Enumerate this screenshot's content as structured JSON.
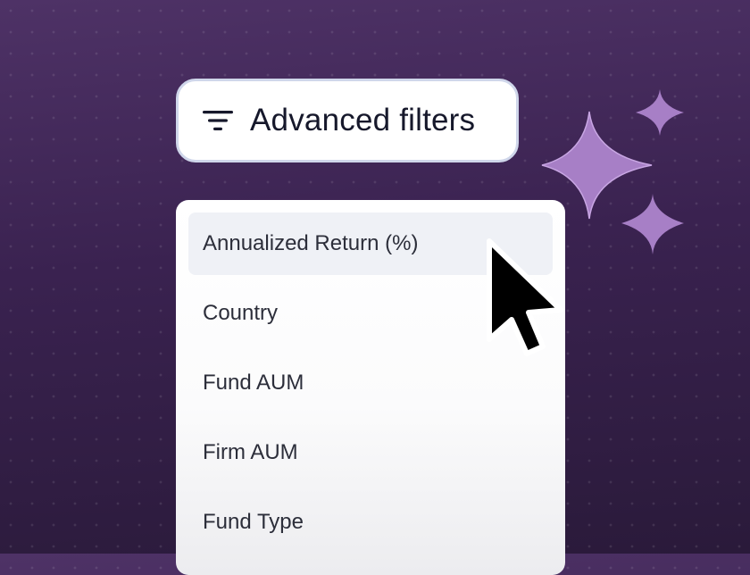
{
  "filters_button": {
    "label": "Advanced filters",
    "icon": "filter-lines-icon"
  },
  "dropdown": {
    "options": [
      {
        "label": "Annualized Return (%)",
        "highlighted": true
      },
      {
        "label": "Country",
        "highlighted": false
      },
      {
        "label": "Fund AUM",
        "highlighted": false
      },
      {
        "label": "Firm AUM",
        "highlighted": false
      },
      {
        "label": "Fund Type",
        "highlighted": false
      }
    ]
  },
  "decorations": {
    "sparkle_color": "#a77fc6",
    "cursor_icon": "pointer-arrow-icon"
  },
  "colors": {
    "background_top": "#4e3266",
    "background_bottom": "#2a1a3a",
    "button_border": "#cfd6ea",
    "highlight_bg": "#eff1f6"
  }
}
